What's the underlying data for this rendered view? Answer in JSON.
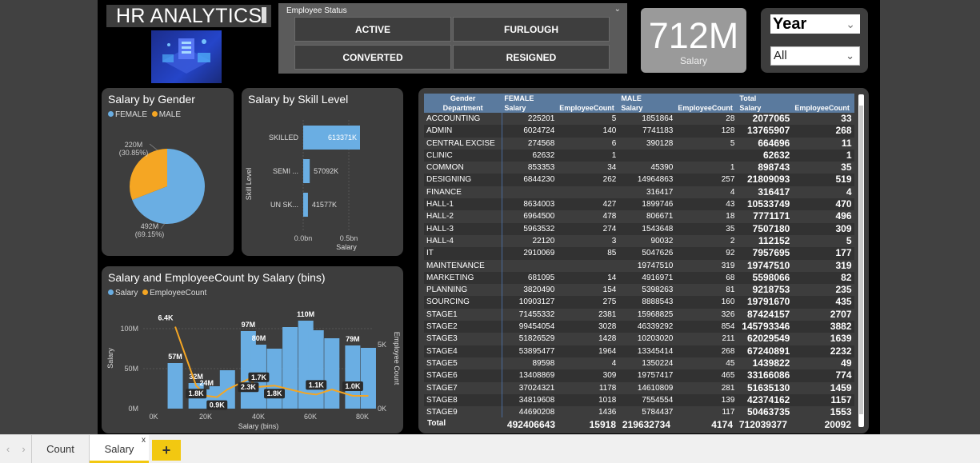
{
  "title": "HR ANALYTICS",
  "status_slicer": {
    "header": "Employee Status",
    "options": [
      "ACTIVE",
      "FURLOUGH",
      "CONVERTED",
      "RESIGNED"
    ]
  },
  "kpi": {
    "value": "712M",
    "label": "Salary"
  },
  "year_slicer": {
    "label": "Year",
    "value": "All"
  },
  "colors": {
    "salary": "#6aaee3",
    "male": "#f5a623",
    "header_blue": "#5a7a9e",
    "accent": "#f2c811"
  },
  "gender_chart": {
    "title": "Salary by Gender",
    "legend": [
      "FEMALE",
      "MALE"
    ],
    "labels": [
      "220M (30.85%)",
      "492M (69.15%)"
    ]
  },
  "skill_chart": {
    "title": "Salary by Skill Level",
    "ylabel": "Skill Level",
    "xlabel": "Salary",
    "ticks": [
      "0.0bn",
      "0.5bn"
    ]
  },
  "bins_chart": {
    "title": "Salary and EmployeeCount by Salary (bins)",
    "legend": [
      "Salary",
      "EmployeeCount"
    ],
    "ylabel": "Salary",
    "y2label": "Employee Count",
    "xlabel": "Salary (bins)",
    "yticks": [
      "100M",
      "50M",
      "0M"
    ],
    "y2ticks": [
      "5K",
      "0K"
    ],
    "xticks": [
      "0K",
      "20K",
      "40K",
      "60K",
      "80K"
    ]
  },
  "chart_data": [
    {
      "type": "pie",
      "title": "Salary by Gender",
      "categories": [
        "FEMALE",
        "MALE"
      ],
      "values": [
        220,
        492
      ],
      "unit": "M",
      "percent": [
        30.85,
        69.15
      ]
    },
    {
      "type": "bar",
      "orientation": "horizontal",
      "title": "Salary by Skill Level",
      "categories": [
        "SKILLED",
        "SEMI ...",
        "UN SK..."
      ],
      "values": [
        613371,
        57092,
        41577
      ],
      "data_labels": [
        "613371K",
        "57092K",
        "41577K"
      ],
      "xlabel": "Salary",
      "ylabel": "Skill Level",
      "xlim": [
        0,
        0.5
      ]
    },
    {
      "type": "bar",
      "title": "Salary and EmployeeCount by Salary (bins)",
      "x": [
        4,
        12,
        16,
        20,
        24,
        32,
        36,
        42,
        48,
        54,
        58,
        64,
        72,
        78
      ],
      "series": [
        {
          "name": "Salary",
          "values": [
            57,
            32,
            24,
            28,
            48,
            97,
            80,
            75,
            102,
            110,
            98,
            88,
            79,
            76
          ],
          "data_labels": [
            "57M",
            "32M",
            "24M",
            "",
            "",
            "97M",
            "80M",
            "",
            "",
            "110M",
            "",
            "",
            "79M",
            ""
          ]
        },
        {
          "name": "EmployeeCount",
          "values": [
            6.4,
            1.8,
            1.0,
            0.9,
            1.5,
            2.3,
            1.7,
            1.8,
            1.5,
            1.2,
            1.1,
            1.5,
            1.0,
            1.0
          ],
          "data_labels": [
            "6.4K",
            "1.8K",
            "",
            "0.9K",
            "",
            "2.3K",
            "1.7K",
            "1.8K",
            "",
            "",
            "1.1K",
            "",
            "1.0K",
            ""
          ]
        }
      ],
      "xlabel": "Salary (bins)",
      "ylabel": "Salary",
      "y2label": "Employee Count",
      "xlim": [
        0,
        80
      ],
      "ylim": [
        0,
        120
      ],
      "y2lim": [
        0,
        7
      ]
    }
  ],
  "matrix": {
    "header1": [
      "Gender",
      "FEMALE",
      "",
      "MALE",
      "",
      "Total",
      ""
    ],
    "header2": [
      "Department",
      "Salary",
      "EmployeeCount",
      "Salary",
      "EmployeeCount",
      "Salary",
      "EmployeeCount"
    ],
    "rows": [
      [
        "ACCOUNTING",
        "225201",
        "5",
        "1851864",
        "28",
        "2077065",
        "33"
      ],
      [
        "ADMIN",
        "6024724",
        "140",
        "7741183",
        "128",
        "13765907",
        "268"
      ],
      [
        "CENTRAL EXCISE",
        "274568",
        "6",
        "390128",
        "5",
        "664696",
        "11"
      ],
      [
        "CLINIC",
        "62632",
        "1",
        "",
        "",
        "62632",
        "1"
      ],
      [
        "COMMON",
        "853353",
        "34",
        "45390",
        "1",
        "898743",
        "35"
      ],
      [
        "DESIGNING",
        "6844230",
        "262",
        "14964863",
        "257",
        "21809093",
        "519"
      ],
      [
        "FINANCE",
        "",
        "",
        "316417",
        "4",
        "316417",
        "4"
      ],
      [
        "HALL-1",
        "8634003",
        "427",
        "1899746",
        "43",
        "10533749",
        "470"
      ],
      [
        "HALL-2",
        "6964500",
        "478",
        "806671",
        "18",
        "7771171",
        "496"
      ],
      [
        "HALL-3",
        "5963532",
        "274",
        "1543648",
        "35",
        "7507180",
        "309"
      ],
      [
        "HALL-4",
        "22120",
        "3",
        "90032",
        "2",
        "112152",
        "5"
      ],
      [
        "IT",
        "2910069",
        "85",
        "5047626",
        "92",
        "7957695",
        "177"
      ],
      [
        "MAINTENANCE",
        "",
        "",
        "19747510",
        "319",
        "19747510",
        "319"
      ],
      [
        "MARKETING",
        "681095",
        "14",
        "4916971",
        "68",
        "5598066",
        "82"
      ],
      [
        "PLANNING",
        "3820490",
        "154",
        "5398263",
        "81",
        "9218753",
        "235"
      ],
      [
        "SOURCING",
        "10903127",
        "275",
        "8888543",
        "160",
        "19791670",
        "435"
      ],
      [
        "STAGE1",
        "71455332",
        "2381",
        "15968825",
        "326",
        "87424157",
        "2707"
      ],
      [
        "STAGE2",
        "99454054",
        "3028",
        "46339292",
        "854",
        "145793346",
        "3882"
      ],
      [
        "STAGE3",
        "51826529",
        "1428",
        "10203020",
        "211",
        "62029549",
        "1639"
      ],
      [
        "STAGE4",
        "53895477",
        "1964",
        "13345414",
        "268",
        "67240891",
        "2232"
      ],
      [
        "STAGE5",
        "89598",
        "4",
        "1350224",
        "45",
        "1439822",
        "49"
      ],
      [
        "STAGE6",
        "13408869",
        "309",
        "19757417",
        "465",
        "33166086",
        "774"
      ],
      [
        "STAGE7",
        "37024321",
        "1178",
        "14610809",
        "281",
        "51635130",
        "1459"
      ],
      [
        "STAGE8",
        "34819608",
        "1018",
        "7554554",
        "139",
        "42374162",
        "1157"
      ],
      [
        "STAGE9",
        "44690208",
        "1436",
        "5784437",
        "117",
        "50463735",
        "1553"
      ]
    ],
    "totals": [
      "Total",
      "492406643",
      "15918",
      "219632734",
      "4174",
      "712039377",
      "20092"
    ]
  },
  "tabs": [
    {
      "label": "Count"
    },
    {
      "label": "Salary",
      "close": "x"
    }
  ],
  "add_tab": "+"
}
